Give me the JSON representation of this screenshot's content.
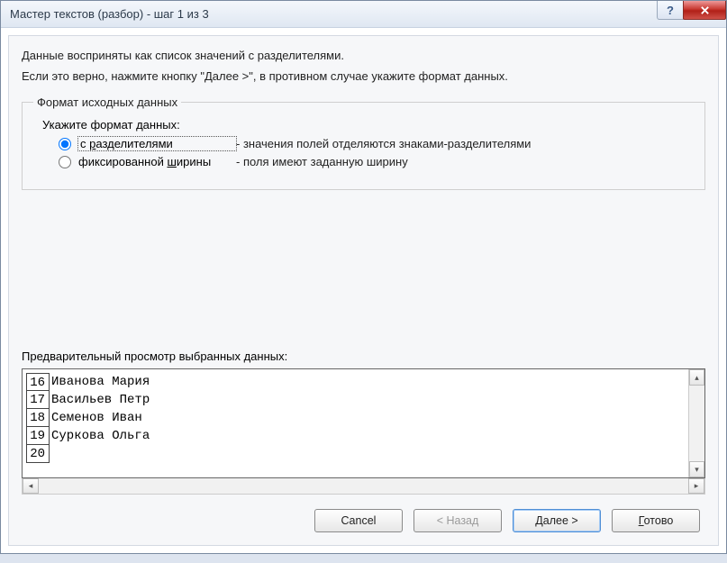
{
  "title": "Мастер текстов (разбор) - шаг 1 из 3",
  "info1": "Данные восприняты как список значений с разделителями.",
  "info2": "Если это верно, нажмите кнопку \"Далее >\", в противном случае укажите формат данных.",
  "group": {
    "legend": "Формат исходных данных",
    "prompt": "Укажите формат данных:",
    "options": [
      {
        "label_pre": "с ",
        "label_u": "р",
        "label_post": "азделителями",
        "desc": "- значения полей отделяются знаками-разделителями",
        "checked": true
      },
      {
        "label_pre": "фиксированной ",
        "label_u": "ш",
        "label_post": "ирины",
        "desc": "- поля имеют заданную ширину",
        "checked": false
      }
    ]
  },
  "preview": {
    "label": "Предварительный просмотр выбранных данных:",
    "rows": [
      {
        "n": "16",
        "t": "Иванова Мария"
      },
      {
        "n": "17",
        "t": "Васильев Петр"
      },
      {
        "n": "18",
        "t": "Семенов Иван"
      },
      {
        "n": "19",
        "t": "Суркова Ольга"
      },
      {
        "n": "20",
        "t": ""
      }
    ]
  },
  "buttons": {
    "cancel": "Cancel",
    "back": "< Назад",
    "next": "Далее >",
    "finish_pre": "",
    "finish_u": "Г",
    "finish_post": "отово"
  }
}
